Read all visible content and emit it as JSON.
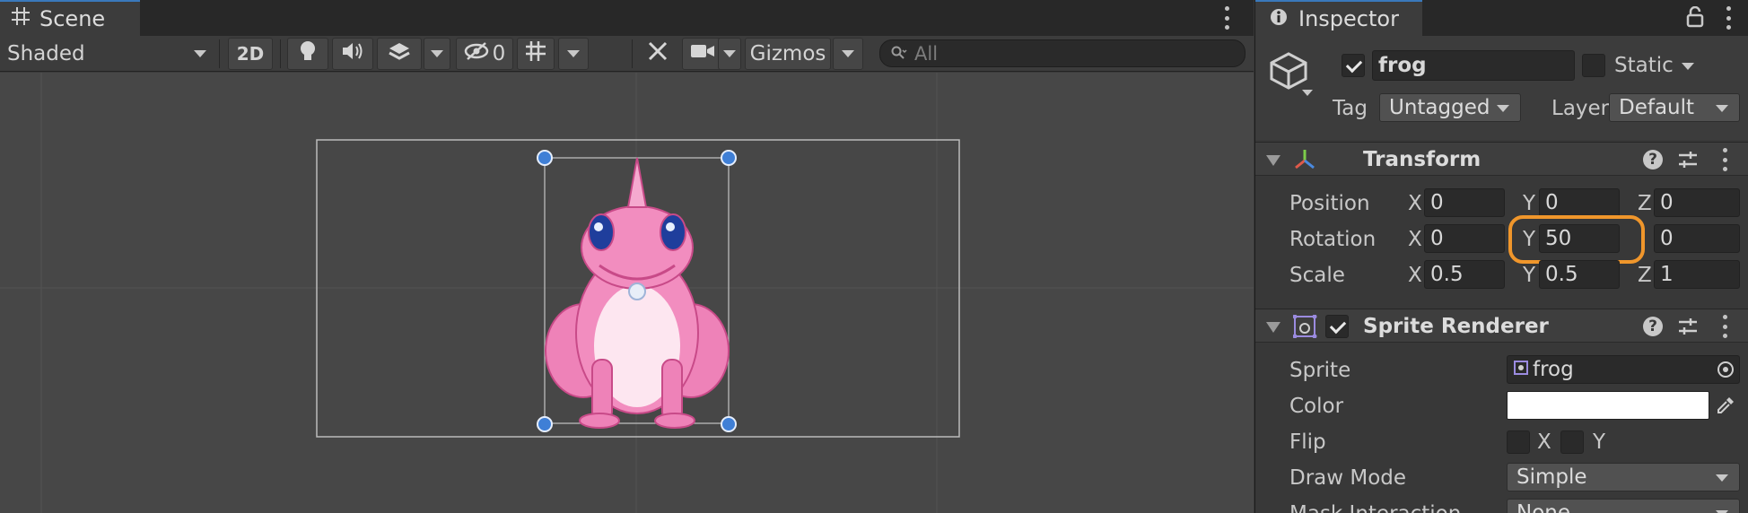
{
  "scene": {
    "tab_label": "Scene",
    "shading_mode": "Shaded",
    "mode_2d_label": "2D",
    "hidden_count": "0",
    "gizmos_label": "Gizmos",
    "search_placeholder": "All"
  },
  "inspector": {
    "tab_label": "Inspector",
    "object": {
      "name": "frog",
      "active": true,
      "static_label": "Static",
      "tag_label": "Tag",
      "tag_value": "Untagged",
      "layer_label": "Layer",
      "layer_value": "Default"
    },
    "transform": {
      "title": "Transform",
      "position": {
        "label": "Position",
        "x": "0",
        "y": "0",
        "z": "0"
      },
      "rotation": {
        "label": "Rotation",
        "x": "0",
        "y": "50",
        "z": "0"
      },
      "scale": {
        "label": "Scale",
        "x": "0.5",
        "y": "0.5",
        "z": "1"
      },
      "axis_x": "X",
      "axis_y": "Y",
      "axis_z": "Z"
    },
    "sprite_renderer": {
      "title": "Sprite Renderer",
      "enabled": true,
      "sprite_label": "Sprite",
      "sprite_value": "frog",
      "color_label": "Color",
      "color_value": "#ffffff",
      "flip_label": "Flip",
      "flip_x": "X",
      "flip_y": "Y",
      "draw_mode_label": "Draw Mode",
      "draw_mode_value": "Simple",
      "mask_interaction_label": "Mask Interaction",
      "mask_interaction_value": "None"
    }
  },
  "colors": {
    "tab_accent": "#3a79bb",
    "highlight": "#f0962b",
    "frog_pink": "#f07fb4",
    "handle_blue": "#3f7fd6"
  }
}
